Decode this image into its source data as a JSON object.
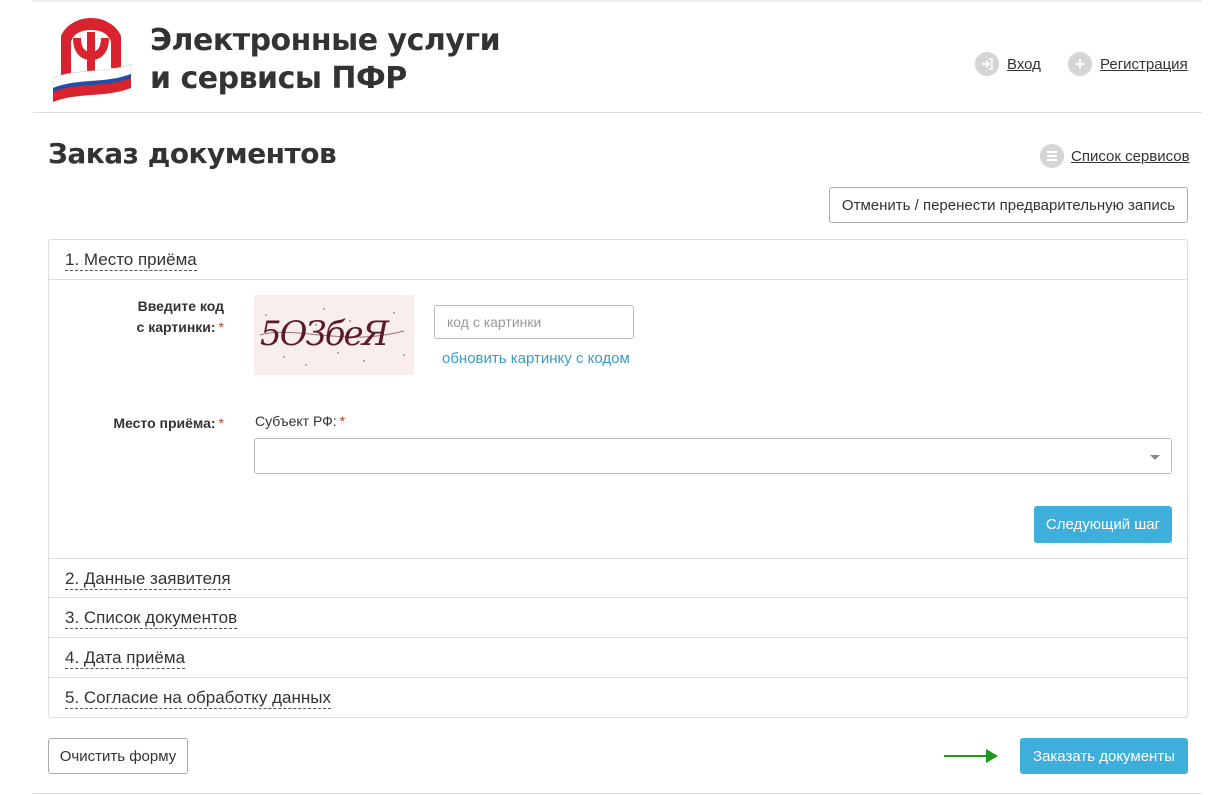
{
  "header": {
    "title_line1": "Электронные услуги",
    "title_line2": "и сервисы ПФР",
    "login_label": "Вход",
    "register_label": "Регистрация"
  },
  "page": {
    "title": "Заказ документов",
    "services_link": "Список сервисов",
    "cancel_button": "Отменить / перенести предварительную запись"
  },
  "form": {
    "sections": [
      {
        "label": "1. Место приёма"
      },
      {
        "label": "2. Данные заявителя"
      },
      {
        "label": "3. Список документов"
      },
      {
        "label": "4. Дата приёма"
      },
      {
        "label": "5. Согласие на обработку данных"
      }
    ],
    "captcha_label_line1": "Введите код",
    "captcha_label_line2": "с картинки:",
    "captcha_input_placeholder": "код с картинки",
    "captcha_refresh_link": "обновить картинку с кодом",
    "captcha_text": "5ОЗбеЯ",
    "place_label": "Место приёма:",
    "subject_label": "Субъект РФ:",
    "subject_value": "",
    "required_mark": "*",
    "next_button": "Следующий шаг"
  },
  "footer": {
    "clear_button": "Очистить форму",
    "order_button": "Заказать документы"
  },
  "colors": {
    "accent_blue": "#3eaedb",
    "link_blue": "#3a9bc7",
    "required_red": "#c0392b",
    "arrow_green": "#1a9a1a"
  }
}
